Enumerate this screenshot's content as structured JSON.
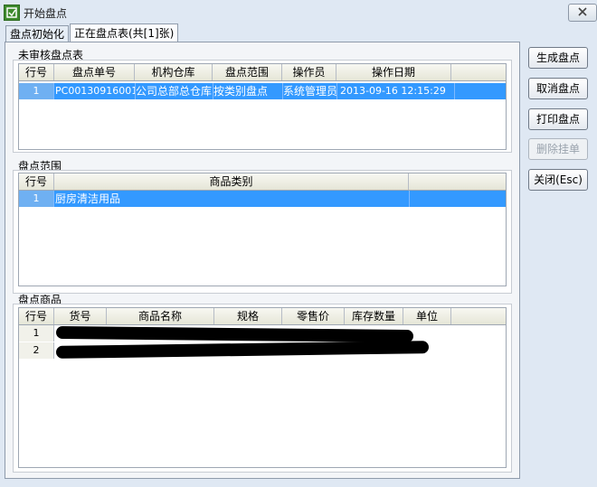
{
  "window": {
    "title": "开始盘点"
  },
  "tabs": [
    {
      "label": "盘点初始化"
    },
    {
      "label": "正在盘点表(共[1]张)"
    }
  ],
  "pending_section": {
    "title": "未审核盘点表",
    "columns": [
      "行号",
      "盘点单号",
      "机构仓库",
      "盘点范围",
      "操作员",
      "操作日期"
    ],
    "rows": [
      {
        "no": "1",
        "order_no": "PC001309160010",
        "warehouse": "公司总部总仓库",
        "scope": "按类别盘点",
        "operator": "系统管理员",
        "date": "2013-09-16 12:15:29"
      }
    ]
  },
  "scope_section": {
    "title": "盘点范围",
    "columns": [
      "行号",
      "商品类别"
    ],
    "rows": [
      {
        "no": "1",
        "category": "厨房清洁用品"
      }
    ]
  },
  "goods_section": {
    "title": "盘点商品",
    "columns": [
      "行号",
      "货号",
      "商品名称",
      "规格",
      "零售价",
      "库存数量",
      "单位"
    ],
    "rows": [
      {
        "no": "1"
      },
      {
        "no": "2"
      }
    ]
  },
  "actions": {
    "generate": "生成盘点",
    "cancel": "取消盘点",
    "print": "打印盘点",
    "delete_hold": "删除挂单",
    "close": "关闭(Esc)"
  }
}
